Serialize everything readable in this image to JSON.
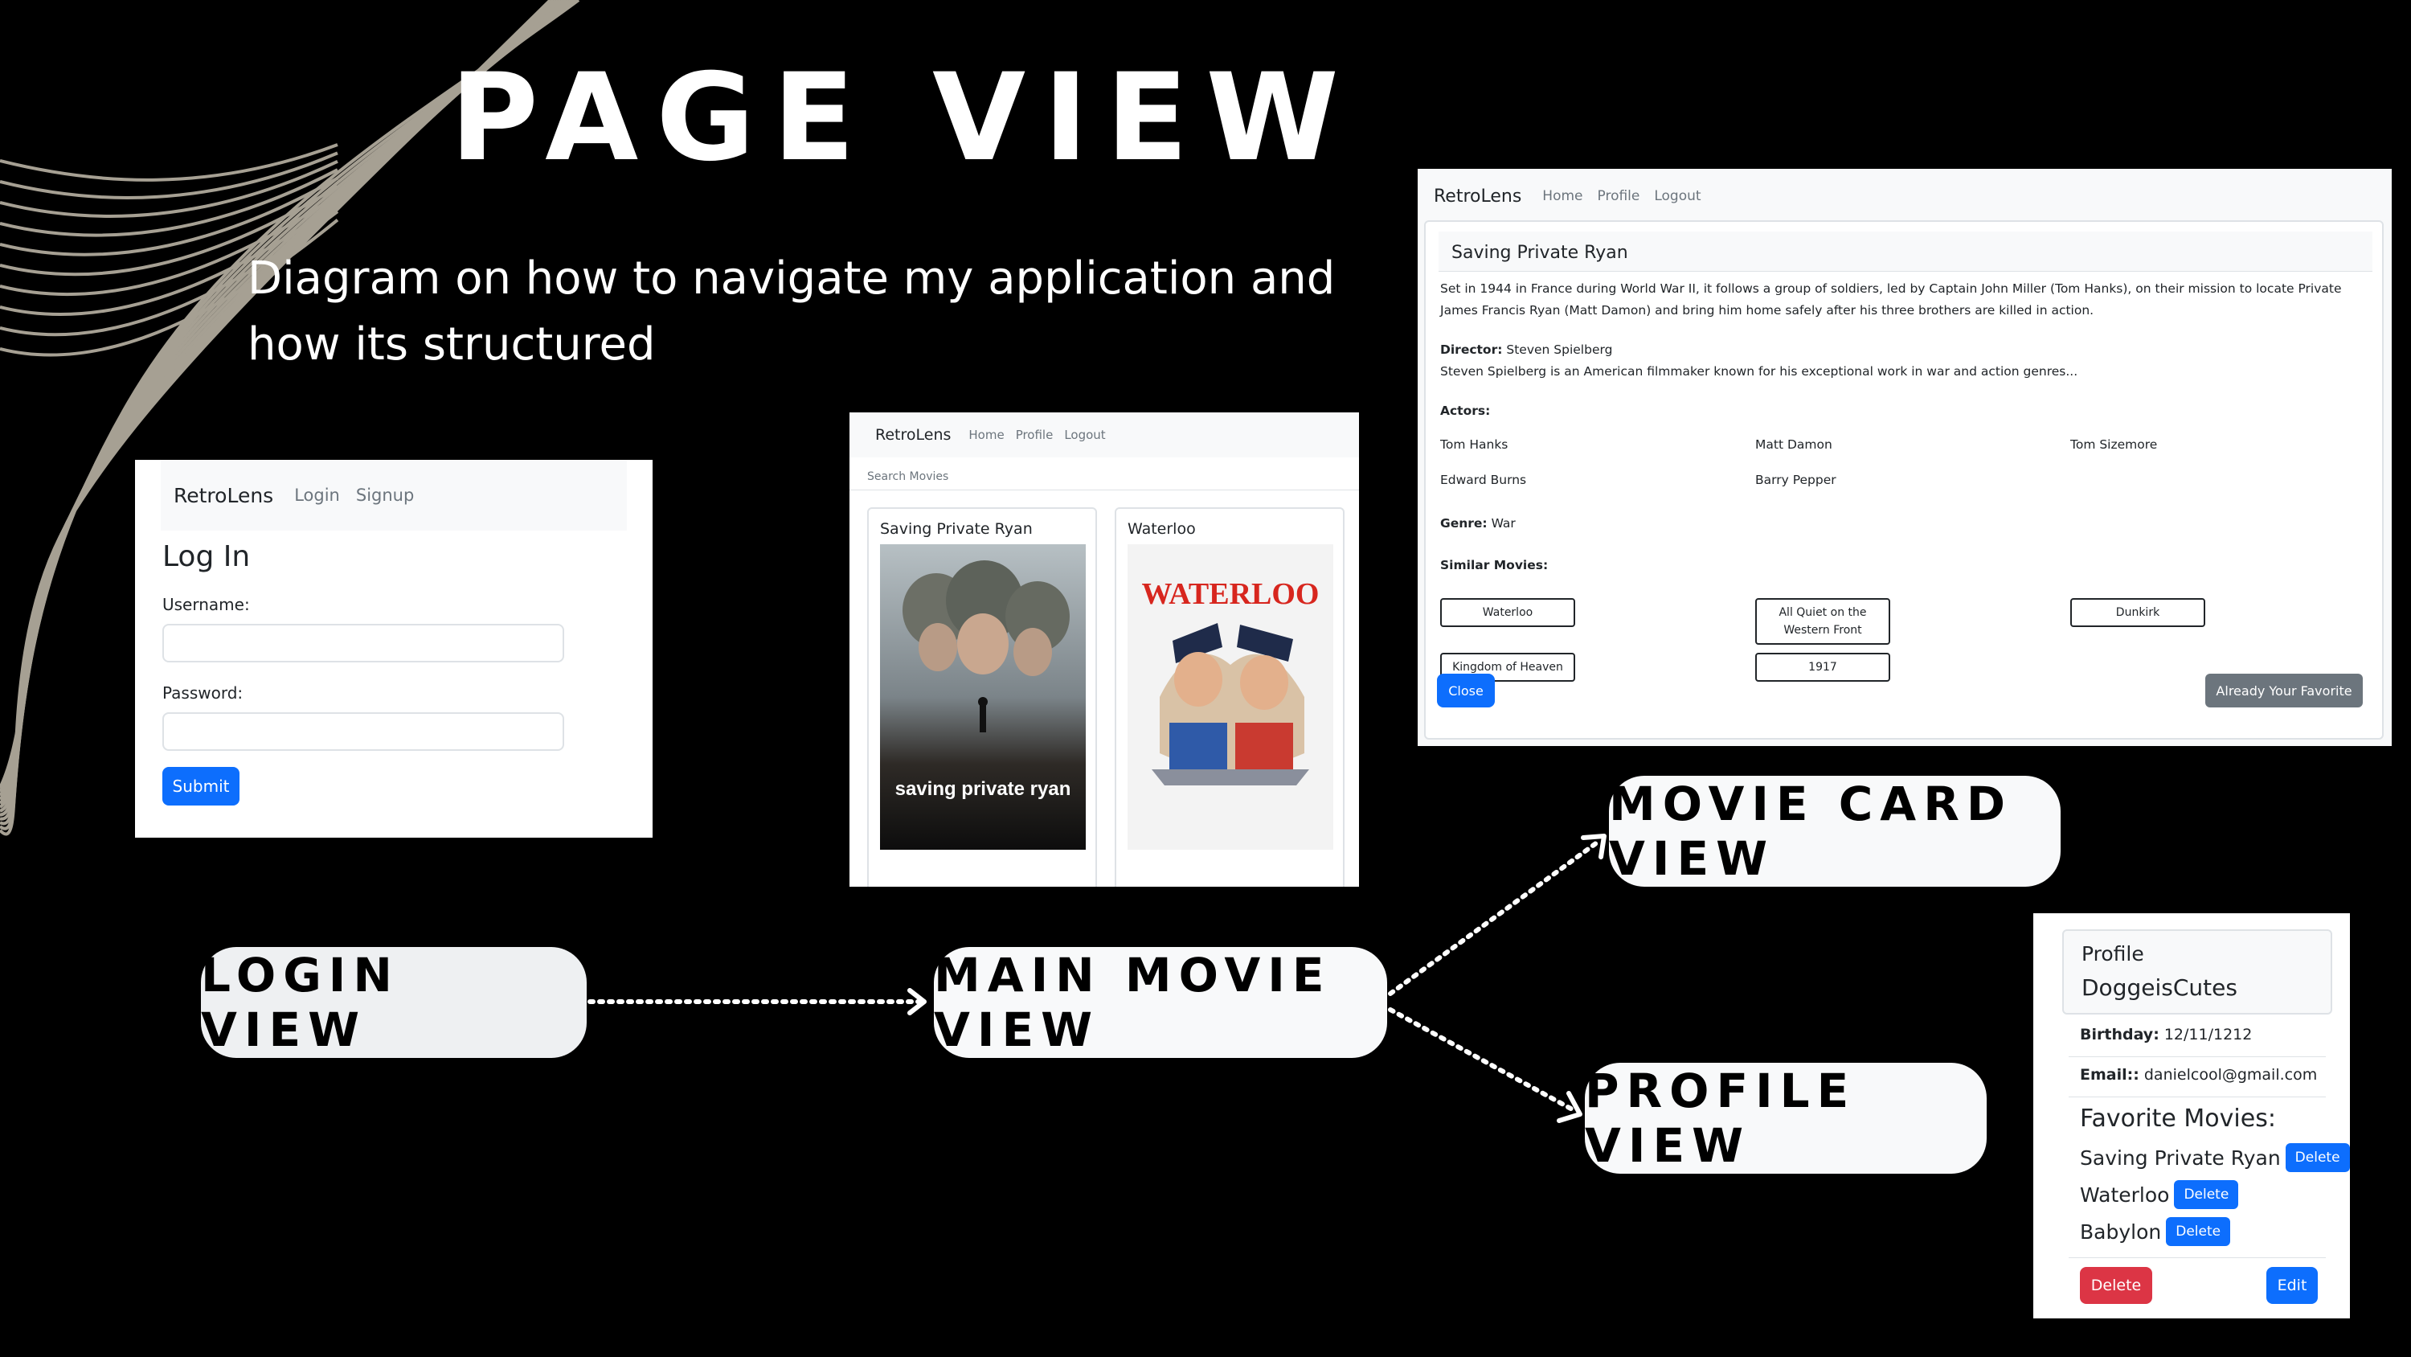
{
  "slide": {
    "title": "PAGE VIEW",
    "subtitle": "Diagram on how to navigate my application and how its structured"
  },
  "labels": {
    "login_view": "LOGIN VIEW",
    "main_movie_view": "MAIN MOVIE VIEW",
    "movie_card_view": "MOVIE CARD VIEW",
    "profile_view": "PROFILE VIEW"
  },
  "login_screen": {
    "brand": "RetroLens",
    "nav": [
      "Login",
      "Signup"
    ],
    "heading": "Log In",
    "username_label": "Username:",
    "password_label": "Password:",
    "submit": "Submit"
  },
  "main_screen": {
    "brand": "RetroLens",
    "nav": [
      "Home",
      "Profile",
      "Logout"
    ],
    "search_placeholder": "Search Movies",
    "cards": [
      {
        "title": "Saving Private Ryan",
        "poster_text": "saving private ryan"
      },
      {
        "title": "Waterloo",
        "poster_text": "WATERLOO"
      }
    ]
  },
  "detail_screen": {
    "brand": "RetroLens",
    "nav": [
      "Home",
      "Profile",
      "Logout"
    ],
    "movie_title": "Saving Private Ryan",
    "description": "Set in 1944 in France during World War II, it follows a group of soldiers, led by Captain John Miller (Tom Hanks), on their mission to locate Private James Francis Ryan (Matt Damon) and bring him home safely after his three brothers are killed in action.",
    "director_label": "Director:",
    "director": "Steven Spielberg",
    "director_bio": "Steven Spielberg is an American filmmaker known for his exceptional work in war and action genres...",
    "actors_label": "Actors:",
    "actors": [
      "Tom Hanks",
      "Matt Damon",
      "Tom Sizemore",
      "Edward Burns",
      "Barry Pepper"
    ],
    "genre_label": "Genre:",
    "genre": "War",
    "similar_label": "Similar Movies:",
    "similar": [
      "Waterloo",
      "All Quiet on the Western Front",
      "Dunkirk",
      "Kingdom of Heaven",
      "1917"
    ],
    "close": "Close",
    "favorite": "Already Your Favorite"
  },
  "profile_screen": {
    "header": "Profile",
    "username": "DoggeisCutes",
    "birthday_label": "Birthday:",
    "birthday": "12/11/1212",
    "email_label": "Email::",
    "email": "danielcool@gmail.com",
    "favorites_label": "Favorite Movies:",
    "favorites": [
      "Saving Private Ryan",
      "Waterloo",
      "Babylon"
    ],
    "remove_label": "Delete",
    "delete": "Delete",
    "edit": "Edit"
  },
  "colors": {
    "background": "#000000",
    "primary": "#0d6efd",
    "danger": "#dc3545",
    "secondary": "#6c757d",
    "pill": "#f8f9fa",
    "wave": "#b8b2a4"
  }
}
